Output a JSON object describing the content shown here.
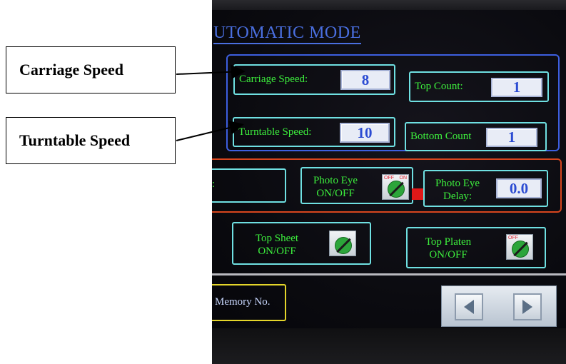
{
  "callouts": {
    "carriage": "Carriage Speed",
    "turntable": "Turntable Speed"
  },
  "screen": {
    "title": "UTOMATIC MODE",
    "carriage_speed": {
      "label": "Carriage Speed:",
      "value": "8"
    },
    "top_count": {
      "label": "Top Count:",
      "value": "1"
    },
    "turntable_speed": {
      "label": "Turntable Speed:",
      "value": "10"
    },
    "bottom_count": {
      "label": "Bottom Count",
      "value": "1"
    },
    "blank_field": {
      "label": ":"
    },
    "photo_eye": {
      "label_line1": "Photo Eye",
      "label_line2": "ON/OFF",
      "switch_state": "on"
    },
    "photo_eye_delay": {
      "label_line1": "Photo Eye",
      "label_line2": "Delay:",
      "value": "0.0"
    },
    "top_sheet": {
      "label_line1": "Top Sheet",
      "label_line2": "ON/OFF",
      "switch_state": "on"
    },
    "top_platen": {
      "label_line1": "Top Platen",
      "label_line2": "ON/OFF",
      "switch_state": "on"
    },
    "memory": {
      "label": "Memory No."
    },
    "switch_text": {
      "off": "OFF",
      "on": "ON"
    }
  },
  "colors": {
    "field_border": "#6fe0e2",
    "label_green": "#3df03d",
    "value_blue": "#2b4bd2",
    "group_blue": "#3d5fe0",
    "group_orange": "#d8461e",
    "memory_yellow": "#e4d52a",
    "indicator_red": "#e01818"
  },
  "icons": {
    "rotary_switch": "rotary-switch-icon",
    "prev": "triangle-left-icon",
    "next": "triangle-right-icon"
  }
}
